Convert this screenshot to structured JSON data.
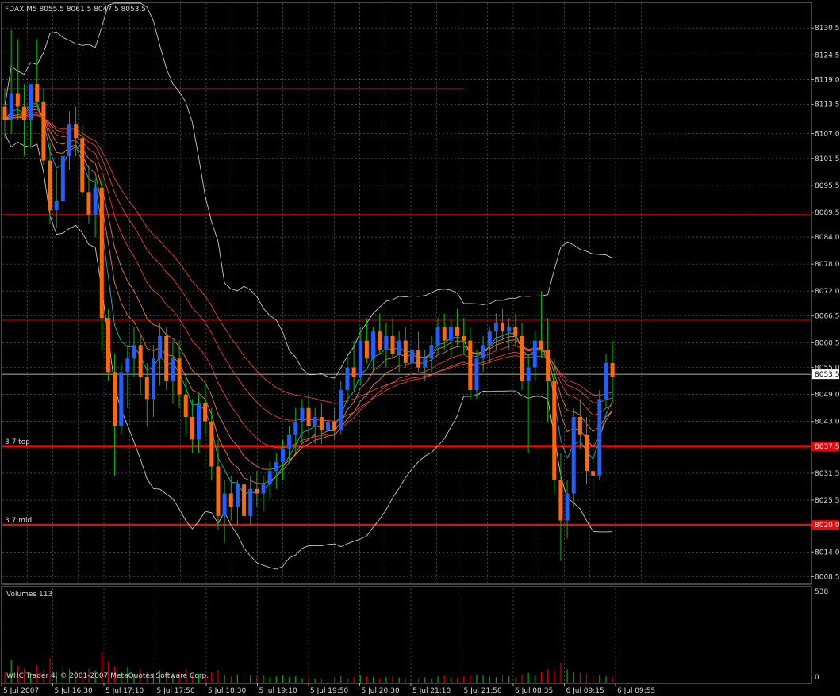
{
  "header": {
    "symbol_info": "FDAX,M5  8055.5 8061.5 8047.5 8053.5"
  },
  "footer": {
    "copyright": "WHC Trader 4, © 2001-2007 MetaQuotes Software Corp."
  },
  "volume_panel": {
    "label": "Volumes 113",
    "max_label": "538",
    "zero_label": "0"
  },
  "colors": {
    "background": "#000000",
    "grid": "#c0c0c0",
    "bull": "#1e5fff",
    "bear": "#ff6a00",
    "wick": "#00c000",
    "level": "#ff0000",
    "bollinger": "#c8c8c8",
    "ma_cyan": "#20c8c8",
    "ma_orange": "#ff8c3c",
    "ma_red": "#ff4a3a",
    "volume_up": "#00b000",
    "volume_down": "#d00000",
    "current_price_tag_bg": "#ffffff"
  },
  "chart_data": {
    "type": "candlestick",
    "symbol": "FDAX",
    "timeframe": "M5",
    "ohlc_last": {
      "open": 8055.5,
      "high": 8061.5,
      "low": 8047.5,
      "close": 8053.5
    },
    "y_ticks": [
      8130.5,
      8124.5,
      8119.0,
      8113.5,
      8107.0,
      8101.5,
      8095.5,
      8089.5,
      8084.0,
      8078.0,
      8072.0,
      8066.5,
      8060.5,
      8055.0,
      8049.0,
      8043.0,
      8037.5,
      8031.5,
      8025.5,
      8020.0,
      8014.0,
      8008.5
    ],
    "x_labels": [
      "5 Jul 2007",
      "5 Jul 16:30",
      "5 Jul 17:10",
      "5 Jul 17:50",
      "5 Jul 18:30",
      "5 Jul 19:10",
      "5 Jul 19:50",
      "5 Jul 20:30",
      "5 Jul 21:10",
      "5 Jul 21:50",
      "6 Jul 08:35",
      "6 Jul 09:15",
      "6 Jul 09:55"
    ],
    "ylim": [
      8007.0,
      8136.0
    ],
    "current_price": 8053.5,
    "horizontal_levels": [
      {
        "price": 8117.0,
        "label": "",
        "style": "thin"
      },
      {
        "price": 8089.0,
        "label": "",
        "style": "thin"
      },
      {
        "price": 8065.5,
        "label": "",
        "style": "thin"
      },
      {
        "price": 8053.5,
        "label": "",
        "style": "white-thin"
      },
      {
        "price": 8037.5,
        "label": "3 7 top",
        "style": "thick"
      },
      {
        "price": 8020.0,
        "label": "3 7 mid",
        "style": "thick"
      }
    ],
    "candles": [
      [
        8113,
        8117,
        8106,
        8110
      ],
      [
        8110,
        8130,
        8107,
        8116
      ],
      [
        8116,
        8128,
        8110,
        8113
      ],
      [
        8113,
        8118,
        8102,
        8110
      ],
      [
        8110,
        8115,
        8104,
        8118
      ],
      [
        8118,
        8128,
        8113,
        8114
      ],
      [
        8114,
        8117,
        8100,
        8101
      ],
      [
        8101,
        8105,
        8087,
        8090
      ],
      [
        8090,
        8099,
        8086,
        8092
      ],
      [
        8092,
        8108,
        8090,
        8102
      ],
      [
        8102,
        8112,
        8099,
        8109
      ],
      [
        8109,
        8113,
        8102,
        8106
      ],
      [
        8106,
        8109,
        8093,
        8094
      ],
      [
        8094,
        8100,
        8087,
        8089
      ],
      [
        8089,
        8097,
        8084,
        8095
      ],
      [
        8095,
        8097,
        8059,
        8066
      ],
      [
        8066,
        8068,
        8052,
        8054
      ],
      [
        8054,
        8058,
        8031,
        8042
      ],
      [
        8042,
        8056,
        8040,
        8054
      ],
      [
        8054,
        8060,
        8046,
        8057
      ],
      [
        8057,
        8064,
        8053,
        8060
      ],
      [
        8060,
        8062,
        8049,
        8053
      ],
      [
        8053,
        8056,
        8042,
        8048
      ],
      [
        8048,
        8060,
        8044,
        8057
      ],
      [
        8057,
        8065,
        8051,
        8062
      ],
      [
        8062,
        8064,
        8050,
        8052
      ],
      [
        8052,
        8061,
        8047,
        8057
      ],
      [
        8057,
        8061,
        8046,
        8049
      ],
      [
        8049,
        8053,
        8040,
        8044
      ],
      [
        8044,
        8048,
        8036,
        8039
      ],
      [
        8039,
        8049,
        8036,
        8047
      ],
      [
        8047,
        8052,
        8040,
        8043
      ],
      [
        8043,
        8046,
        8030,
        8033
      ],
      [
        8033,
        8039,
        8019,
        8022
      ],
      [
        8022,
        8030,
        8016,
        8027
      ],
      [
        8027,
        8031,
        8021,
        8024
      ],
      [
        8024,
        8030,
        8020,
        8029
      ],
      [
        8029,
        8031,
        8019,
        8022
      ],
      [
        8022,
        8031,
        8020,
        8028
      ],
      [
        8028,
        8032,
        8024,
        8027
      ],
      [
        8027,
        8031,
        8023,
        8029
      ],
      [
        8029,
        8034,
        8026,
        8032
      ],
      [
        8032,
        8036,
        8028,
        8034
      ],
      [
        8034,
        8039,
        8030,
        8037
      ],
      [
        8037,
        8042,
        8034,
        8040
      ],
      [
        8040,
        8046,
        8036,
        8043
      ],
      [
        8043,
        8048,
        8038,
        8046
      ],
      [
        8046,
        8049,
        8040,
        8042
      ],
      [
        8042,
        8046,
        8038,
        8044
      ],
      [
        8044,
        8047,
        8038,
        8041
      ],
      [
        8041,
        8045,
        8038,
        8043
      ],
      [
        8043,
        8046,
        8039,
        8041
      ],
      [
        8041,
        8052,
        8040,
        8050
      ],
      [
        8050,
        8058,
        8047,
        8055
      ],
      [
        8055,
        8061,
        8050,
        8053
      ],
      [
        8053,
        8064,
        8051,
        8061
      ],
      [
        8061,
        8066,
        8056,
        8057
      ],
      [
        8057,
        8064,
        8054,
        8063
      ],
      [
        8063,
        8067,
        8058,
        8059
      ],
      [
        8059,
        8065,
        8055,
        8062
      ],
      [
        8062,
        8066,
        8057,
        8058
      ],
      [
        8058,
        8063,
        8054,
        8061
      ],
      [
        8061,
        8064,
        8055,
        8056
      ],
      [
        8056,
        8061,
        8053,
        8059
      ],
      [
        8059,
        8063,
        8054,
        8055
      ],
      [
        8055,
        8059,
        8052,
        8057
      ],
      [
        8057,
        8062,
        8054,
        8060
      ],
      [
        8060,
        8066,
        8058,
        8064
      ],
      [
        8064,
        8067,
        8059,
        8061
      ],
      [
        8061,
        8066,
        8057,
        8064
      ],
      [
        8064,
        8068,
        8060,
        8062
      ],
      [
        8062,
        8066,
        8058,
        8061
      ],
      [
        8061,
        8064,
        8048,
        8050
      ],
      [
        8050,
        8059,
        8048,
        8057
      ],
      [
        8057,
        8062,
        8054,
        8060
      ],
      [
        8060,
        8064,
        8056,
        8063
      ],
      [
        8063,
        8067,
        8059,
        8065
      ],
      [
        8065,
        8068,
        8061,
        8063
      ],
      [
        8063,
        8066,
        8059,
        8064
      ],
      [
        8064,
        8067,
        8060,
        8062
      ],
      [
        8062,
        8065,
        8050,
        8052
      ],
      [
        8052,
        8058,
        8036,
        8055
      ],
      [
        8055,
        8063,
        8052,
        8061
      ],
      [
        8061,
        8072,
        8057,
        8059
      ],
      [
        8059,
        8066,
        8043,
        8052
      ],
      [
        8052,
        8057,
        8027,
        8030
      ],
      [
        8030,
        8036,
        8012,
        8021
      ],
      [
        8021,
        8030,
        8017,
        8027
      ],
      [
        8027,
        8046,
        8024,
        8044
      ],
      [
        8044,
        8048,
        8037,
        8040
      ],
      [
        8040,
        8044,
        8029,
        8032
      ],
      [
        8032,
        8039,
        8026,
        8031
      ],
      [
        8031,
        8050,
        8030,
        8048
      ],
      [
        8048,
        8058,
        8046,
        8056
      ],
      [
        8056,
        8061,
        8047,
        8053
      ]
    ],
    "volumes": [
      60,
      130,
      95,
      80,
      55,
      100,
      70,
      140,
      60,
      90,
      75,
      65,
      50,
      80,
      70,
      170,
      120,
      90,
      60,
      85,
      50,
      75,
      60,
      55,
      70,
      40,
      55,
      60,
      75,
      45,
      50,
      40,
      60,
      70,
      40,
      35,
      45,
      30,
      40,
      35,
      40,
      30,
      35,
      40,
      30,
      35,
      25,
      30,
      20,
      25,
      20,
      30,
      35,
      25,
      30,
      40,
      35,
      30,
      25,
      30,
      35,
      30,
      25,
      30,
      25,
      30,
      25,
      35,
      40,
      30,
      25,
      35,
      40,
      45,
      40,
      35,
      30,
      40,
      35,
      30,
      45,
      55,
      40,
      60,
      75,
      70,
      110,
      75,
      60,
      55,
      50,
      45,
      40,
      35,
      30
    ],
    "volume_max": 538
  }
}
